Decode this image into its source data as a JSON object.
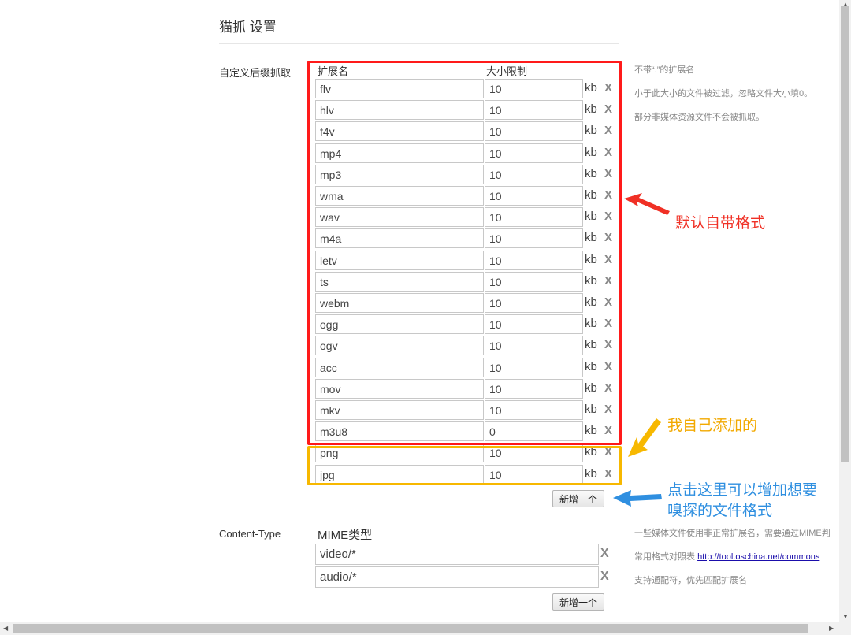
{
  "page": {
    "title": "猫抓 设置"
  },
  "suffix_section": {
    "label": "自定义后缀抓取",
    "col_ext": "扩展名",
    "col_size": "大小限制",
    "unit": "kb",
    "remove": "X",
    "rows": [
      {
        "ext": "flv",
        "size": "10"
      },
      {
        "ext": "hlv",
        "size": "10"
      },
      {
        "ext": "f4v",
        "size": "10"
      },
      {
        "ext": "mp4",
        "size": "10"
      },
      {
        "ext": "mp3",
        "size": "10"
      },
      {
        "ext": "wma",
        "size": "10"
      },
      {
        "ext": "wav",
        "size": "10"
      },
      {
        "ext": "m4a",
        "size": "10"
      },
      {
        "ext": "letv",
        "size": "10"
      },
      {
        "ext": "ts",
        "size": "10"
      },
      {
        "ext": "webm",
        "size": "10"
      },
      {
        "ext": "ogg",
        "size": "10"
      },
      {
        "ext": "ogv",
        "size": "10"
      },
      {
        "ext": "acc",
        "size": "10"
      },
      {
        "ext": "mov",
        "size": "10"
      },
      {
        "ext": "mkv",
        "size": "10"
      },
      {
        "ext": "m3u8",
        "size": "0"
      },
      {
        "ext": "png",
        "size": "10"
      },
      {
        "ext": "jpg",
        "size": "10"
      }
    ],
    "add_button": "新增一个",
    "hints": [
      "不带“.”的扩展名",
      "小于此大小的文件被过滤，忽略文件大小填0。",
      "部分非媒体资源文件不会被抓取。"
    ]
  },
  "mime_section": {
    "label": "Content-Type",
    "col_header": "MIME类型",
    "remove": "X",
    "rows": [
      "video/*",
      "audio/*"
    ],
    "add_button": "新增一个",
    "hints": {
      "line1": "一些媒体文件使用非正常扩展名，需要通过MIME判",
      "line2_prefix": "常用格式对照表 ",
      "line2_link": "http://tool.oschina.net/commons",
      "line3": "支持通配符，优先匹配扩展名"
    }
  },
  "annotations": {
    "default_formats": "默认自带格式",
    "user_added": "我自己添加的",
    "add_hint_line1": "点击这里可以增加想要",
    "add_hint_line2": "嗅探的文件格式"
  },
  "colors": {
    "default_box": "#ff1a1a",
    "added_box": "#f7b800",
    "hint_arrow": "#2f8fe0"
  }
}
